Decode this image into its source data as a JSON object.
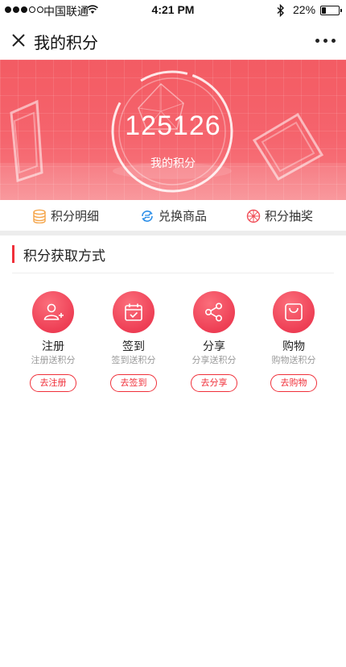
{
  "status_bar": {
    "carrier": "中国联通",
    "time": "4:21 PM",
    "battery": "22%",
    "battery_level": 0.22,
    "signal_strength": 3,
    "icons": [
      "signal-dots-icon",
      "wifi-icon",
      "bluetooth-icon",
      "battery-icon"
    ]
  },
  "nav": {
    "title": "我的积分",
    "icons": [
      "close-icon",
      "more-icon"
    ]
  },
  "banner": {
    "points": "125126",
    "label": "我的积分",
    "accent": "#f35b63"
  },
  "menu": [
    {
      "label": "积分明细",
      "icon": "coins-icon",
      "color": "#f5a54a"
    },
    {
      "label": "兑换商品",
      "icon": "exchange-icon",
      "color": "#2b8ee8"
    },
    {
      "label": "积分抽奖",
      "icon": "wheel-icon",
      "color": "#f0505a"
    }
  ],
  "section": {
    "title": "积分获取方式"
  },
  "methods": [
    {
      "name": "注册",
      "desc": "注册送积分",
      "button": "去注册",
      "icon": "add-user-icon"
    },
    {
      "name": "签到",
      "desc": "签到送积分",
      "button": "去签到",
      "icon": "calendar-check-icon"
    },
    {
      "name": "分享",
      "desc": "分享送积分",
      "button": "去分享",
      "icon": "share-icon"
    },
    {
      "name": "购物",
      "desc": "购物送积分",
      "button": "去购物",
      "icon": "shopping-bag-icon"
    }
  ],
  "colors": {
    "primary": "#f0303a",
    "icon_gradient": "#ee3f55"
  }
}
